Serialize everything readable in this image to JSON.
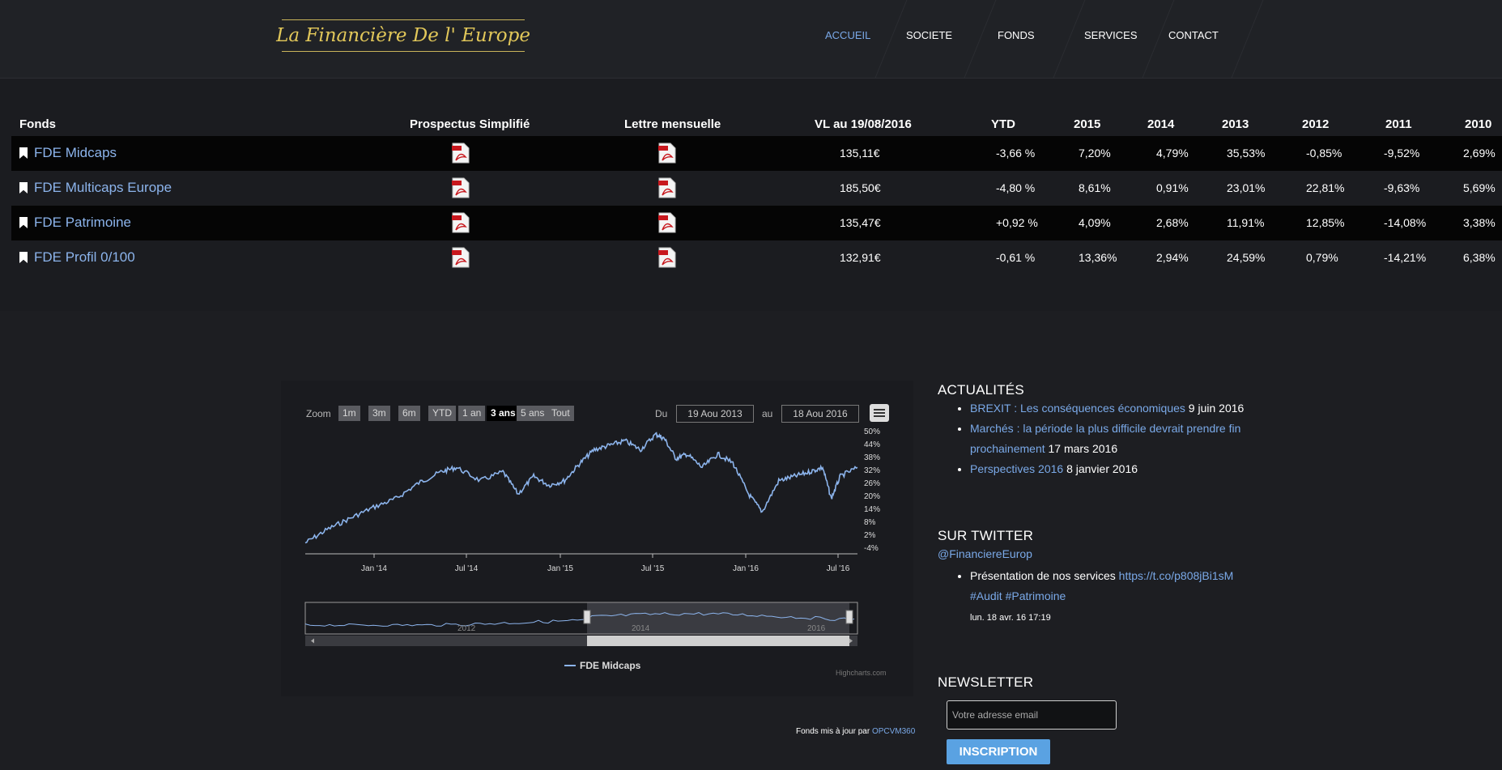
{
  "header": {
    "logo_text": "La Financière De l' Europe",
    "nav": [
      {
        "label": "ACCUEIL",
        "active": true
      },
      {
        "label": "SOCIETE",
        "active": false
      },
      {
        "label": "FONDS",
        "active": false
      },
      {
        "label": "SERVICES",
        "active": false
      },
      {
        "label": "CONTACT",
        "active": false
      }
    ]
  },
  "funds_table": {
    "headers": [
      "Fonds",
      "Prospectus Simplifié",
      "Lettre mensuelle",
      "VL au 19/08/2016",
      "YTD",
      "2015",
      "2014",
      "2013",
      "2012",
      "2011",
      "2010"
    ],
    "rows": [
      {
        "name": "FDE Midcaps",
        "vl": "135,11€",
        "ytd": "-3,66 %",
        "y2015": "7,20%",
        "y2014": "4,79%",
        "y2013": "35,53%",
        "y2012": "-0,85%",
        "y2011": "-9,52%",
        "y2010": "2,69%"
      },
      {
        "name": "FDE Multicaps Europe",
        "vl": "185,50€",
        "ytd": "-4,80 %",
        "y2015": "8,61%",
        "y2014": "0,91%",
        "y2013": "23,01%",
        "y2012": "22,81%",
        "y2011": "-9,63%",
        "y2010": "5,69%"
      },
      {
        "name": "FDE Patrimoine",
        "vl": "135,47€",
        "ytd": "+0,92 %",
        "y2015": "4,09%",
        "y2014": "2,68%",
        "y2013": "11,91%",
        "y2012": "12,85%",
        "y2011": "-14,08%",
        "y2010": "3,38%"
      },
      {
        "name": "FDE Profil 0/100",
        "vl": "132,91€",
        "ytd": "-0,61 %",
        "y2015": "13,36%",
        "y2014": "2,94%",
        "y2013": "24,59%",
        "y2012": "0,79%",
        "y2011": "-14,21%",
        "y2010": "6,38%"
      }
    ],
    "pdf_icon": "pdf-icon"
  },
  "chart_controls": {
    "zoom_label": "Zoom",
    "zoom_buttons": [
      "1m",
      "3m",
      "6m",
      "YTD",
      "1 an",
      "3 ans",
      "5 ans",
      "Tout"
    ],
    "selected_zoom": "3 ans",
    "from_label": "Du",
    "from_value": "19 Aou 2013",
    "to_label": "au",
    "to_value": "18 Aou 2016",
    "menu_icon": "hamburger-menu-icon"
  },
  "chart_data": {
    "type": "line",
    "title": "",
    "xlabel": "",
    "ylabel": "",
    "x_ticks": [
      "Jan '14",
      "Jul '14",
      "Jan '15",
      "Jul '15",
      "Jan '16",
      "Jul '16"
    ],
    "y_ticks": [
      "50%",
      "44%",
      "38%",
      "32%",
      "26%",
      "20%",
      "14%",
      "8%",
      "2%",
      "-4%"
    ],
    "ylim": [
      -4,
      50
    ],
    "series": [
      {
        "name": "FDE Midcaps",
        "color": "#8cb4ec",
        "x": [
          "2013-08-19",
          "2013-10-01",
          "2013-11-15",
          "2014-01-01",
          "2014-02-15",
          "2014-04-01",
          "2014-05-15",
          "2014-06-15",
          "2014-08-01",
          "2014-09-15",
          "2014-10-15",
          "2014-11-15",
          "2014-12-15",
          "2015-01-15",
          "2015-02-15",
          "2015-03-15",
          "2015-04-15",
          "2015-05-15",
          "2015-06-15",
          "2015-07-15",
          "2015-08-01",
          "2015-08-24",
          "2015-09-15",
          "2015-10-15",
          "2015-11-15",
          "2015-12-15",
          "2016-01-15",
          "2016-02-11",
          "2016-03-15",
          "2016-04-15",
          "2016-05-15",
          "2016-06-10",
          "2016-06-27",
          "2016-07-15",
          "2016-08-18"
        ],
        "values": [
          -2,
          4,
          9,
          14,
          18,
          25,
          30,
          32,
          26,
          30,
          20,
          28,
          24,
          26,
          34,
          40,
          42,
          44,
          40,
          47,
          45,
          36,
          38,
          32,
          38,
          34,
          20,
          12,
          26,
          28,
          30,
          32,
          18,
          28,
          32
        ]
      }
    ],
    "navigator": {
      "x_labels": [
        "2012",
        "2014",
        "2016"
      ]
    },
    "legend_placement": "bottom-center",
    "grid": false
  },
  "chart_footer": {
    "credits": "Highcharts.com",
    "source_prefix": "Fonds mis à jour par",
    "source_link": "OPCVM360"
  },
  "news": {
    "title": "ACTUALITÉS",
    "items": [
      {
        "link": "BREXIT : Les conséquences économiques",
        "date": "9 juin 2016"
      },
      {
        "link": "Marchés : la période la plus difficile devrait prendre fin prochainement",
        "date": "17 mars 2016"
      },
      {
        "link": "Perspectives 2016",
        "date": "8 janvier 2016"
      }
    ]
  },
  "twitter": {
    "title": "SUR TWITTER",
    "handle": "@FinanciereEurop",
    "tweet_text": "Présentation de nos services",
    "tweet_url": "https://t.co/p808jBi1sM",
    "tweet_tags": "#Audit #Patrimoine",
    "tweet_date": "lun. 18 avr. 16 17:19"
  },
  "newsletter": {
    "title": "NEWSLETTER",
    "placeholder": "Votre adresse email",
    "button": "INSCRIPTION"
  }
}
